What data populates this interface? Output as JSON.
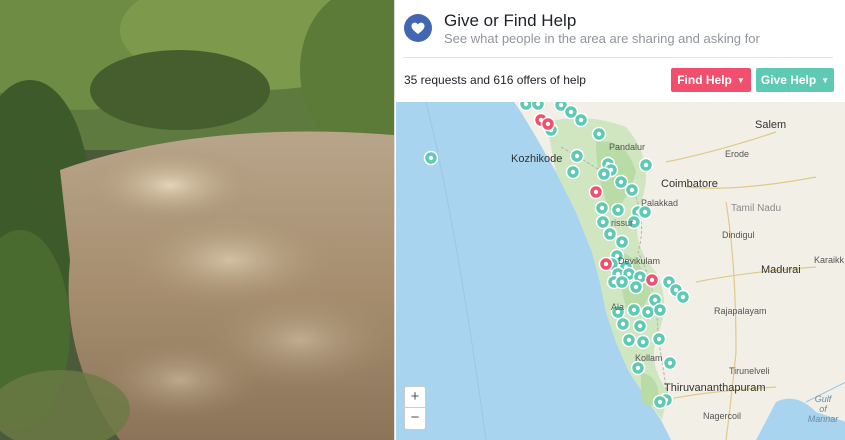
{
  "header": {
    "title": "Give or Find Help",
    "subtitle": "See what people in the area are sharing and asking for"
  },
  "toolbar": {
    "counts_text": "35 requests and 616 offers of help",
    "find_help_label": "Find Help",
    "give_help_label": "Give Help"
  },
  "map": {
    "zoom_in": "+",
    "zoom_out": "−",
    "places": {
      "salem": "Salem",
      "kozhikode": "Kozhikode",
      "pandalur": "Pandalur",
      "erode": "Erode",
      "coimbatore": "Coimbatore",
      "palakkad": "Palakkad",
      "tamil_nadu": "Tamil Nadu",
      "thrissur": "rissur",
      "dindigul": "Dindigul",
      "devikulam": "Devikulam",
      "madurai": "Madurai",
      "karaikudi": "Karaikk",
      "rajapalayam": "Rajapalayam",
      "kollam": "Kollam",
      "tirunelveli": "Tirunelveli",
      "thiruvananthapuram": "Thiruvananthapuram",
      "nagercoil": "Nagercoil",
      "gulf": "Gulf\nof\nMannar",
      "ala": "Ala"
    },
    "marker_colors": {
      "offer": "#5fcab3",
      "request": "#f0506e"
    }
  },
  "colors": {
    "accent": "#4267b2",
    "find": "#f0506e",
    "give": "#5fcab3"
  }
}
